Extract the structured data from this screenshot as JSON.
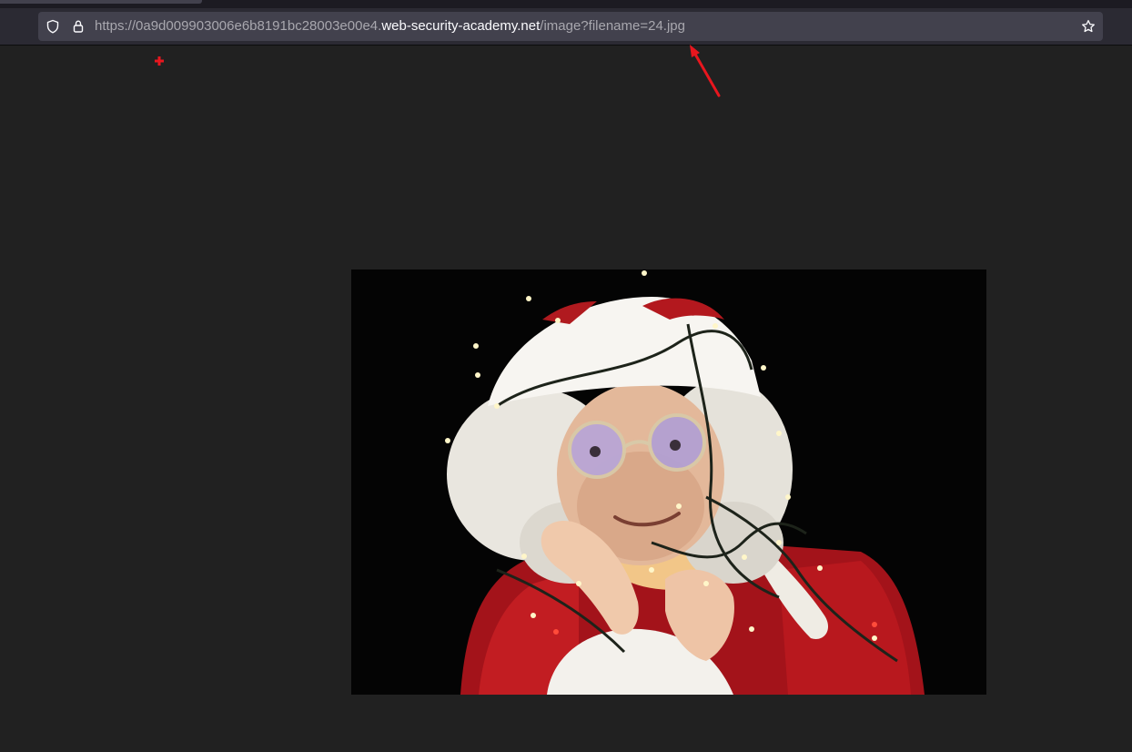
{
  "browser": {
    "url_prefix": "https://0a9d009903006e6b8191bc28003e00e4.",
    "url_host": "web-security-academy.net",
    "url_path": "/image?filename=24.jpg"
  },
  "icons": {
    "tracking_protection": "shield-icon",
    "security": "lock-icon",
    "bookmark": "star-icon"
  },
  "annotations": {
    "arrow_color": "#e8161e",
    "marker_color": "#e8161e"
  },
  "page": {
    "image_subject": "santa-with-lights-photo"
  }
}
